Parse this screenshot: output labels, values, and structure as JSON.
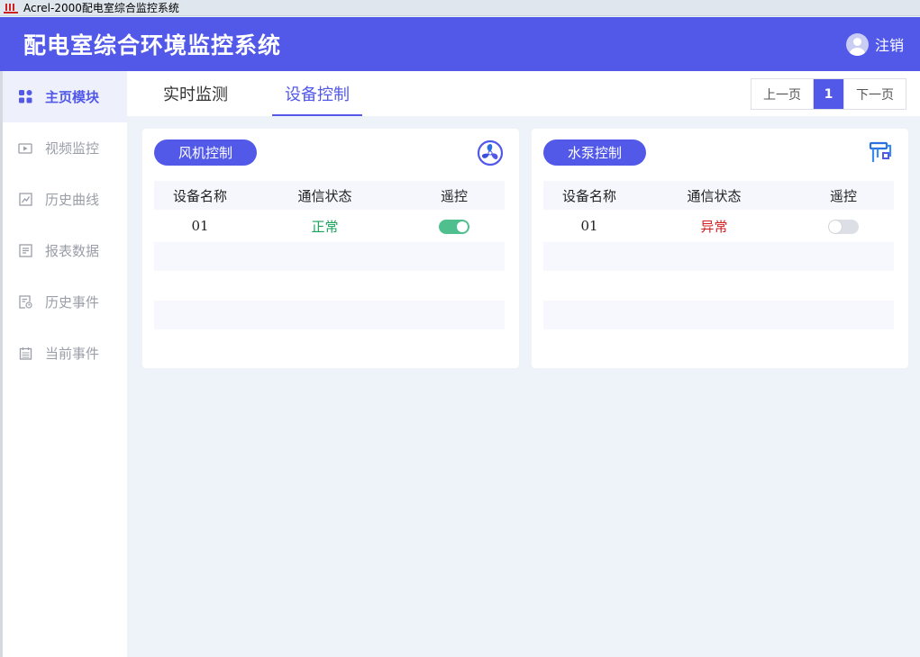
{
  "window": {
    "title": "Acrel-2000配电室综合监控系统"
  },
  "header": {
    "title": "配电室综合环境监控系统",
    "logout_label": "注销"
  },
  "sidebar": {
    "items": [
      {
        "label": "主页模块",
        "icon": "grid-icon",
        "active": true
      },
      {
        "label": "视频监控",
        "icon": "video-icon"
      },
      {
        "label": "历史曲线",
        "icon": "chart-icon"
      },
      {
        "label": "报表数据",
        "icon": "report-icon"
      },
      {
        "label": "历史事件",
        "icon": "history-event-icon"
      },
      {
        "label": "当前事件",
        "icon": "calendar-icon"
      }
    ]
  },
  "tabs": [
    {
      "label": "实时监测",
      "active": false
    },
    {
      "label": "设备控制",
      "active": true
    }
  ],
  "pager": {
    "prev": "上一页",
    "current": "1",
    "next": "下一页"
  },
  "fan_panel": {
    "title": "风机控制",
    "icon": "fan-icon",
    "columns": [
      "设备名称",
      "通信状态",
      "遥控"
    ],
    "rows": [
      {
        "name": "01",
        "status": "正常",
        "remote_on": true
      }
    ]
  },
  "pump_panel": {
    "title": "水泵控制",
    "icon": "water-pump-icon",
    "columns": [
      "设备名称",
      "通信状态",
      "遥控"
    ],
    "rows": [
      {
        "name": "01",
        "status": "异常",
        "remote_on": false
      }
    ]
  },
  "colors": {
    "primary": "#5259e8",
    "ok": "#1aa35a",
    "error": "#d42020",
    "toggle_on": "#4fc08d"
  }
}
